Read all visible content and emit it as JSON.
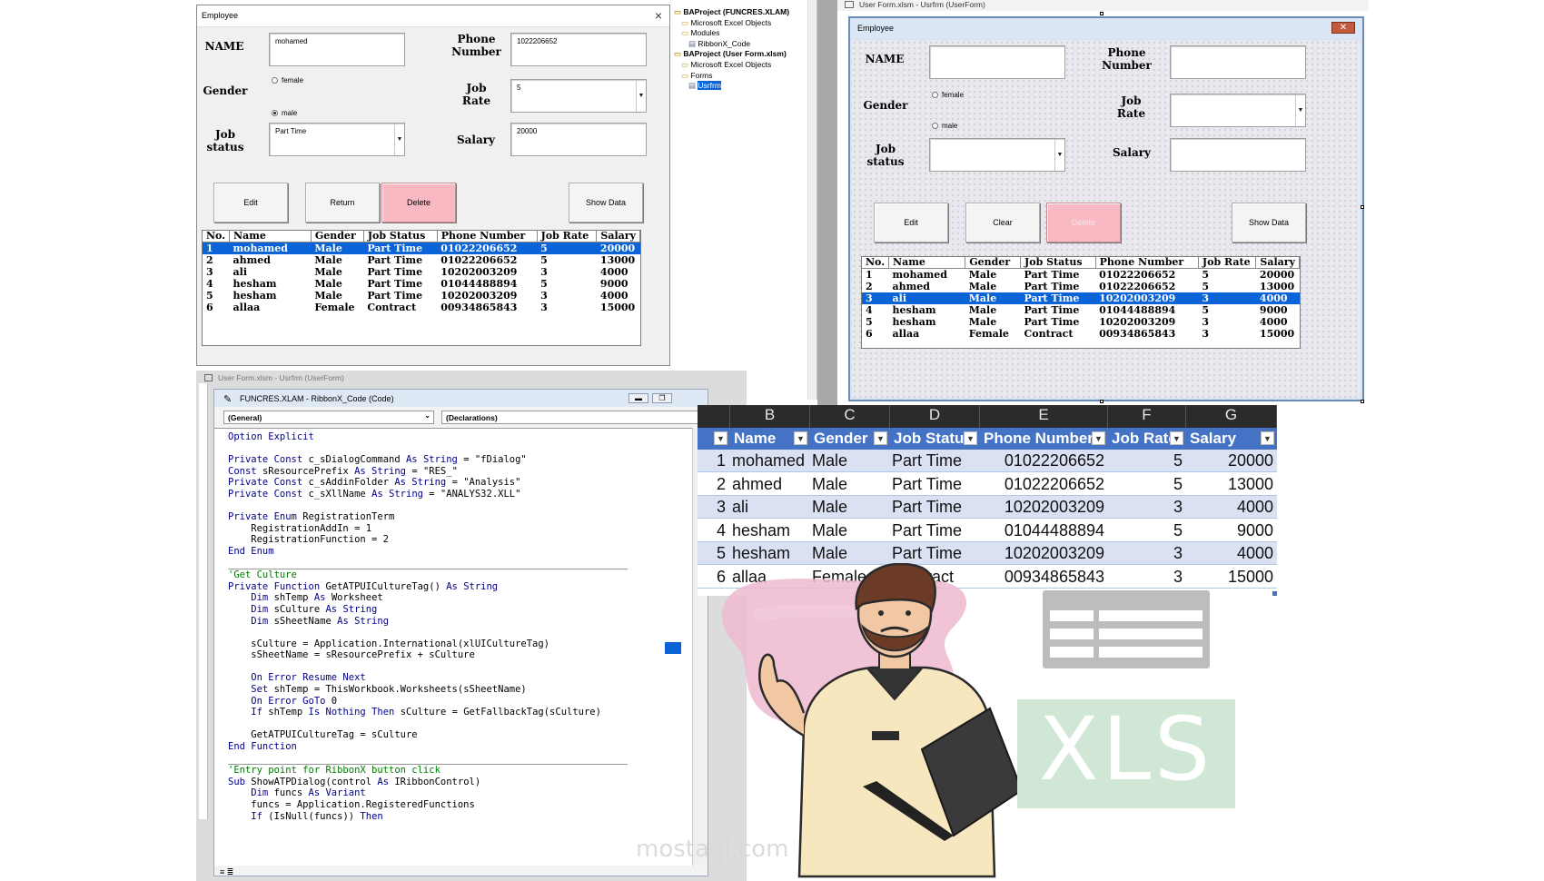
{
  "form1": {
    "title": "Employee",
    "labels": {
      "name": "NAME",
      "phone": "Phone Number",
      "gender": "Gender",
      "job_rate": "Job Rate",
      "job_status": "Job status",
      "salary": "Salary"
    },
    "values": {
      "name": "mohamed",
      "phone": "1022206652",
      "job_rate": "5",
      "job_status": "Part Time",
      "salary": "20000"
    },
    "radios": {
      "female": "female",
      "male": "male"
    },
    "buttons": {
      "edit": "Edit",
      "return": "Return",
      "delete": "Delete",
      "show": "Show Data"
    },
    "columns": [
      "No.",
      "Name",
      "Gender",
      "Job Status",
      "Phone Number",
      "Job Rate",
      "Salary"
    ],
    "selected_row": 0,
    "rows": [
      [
        "1",
        "mohamed",
        "Male",
        "Part Time",
        "01022206652",
        "5",
        "20000"
      ],
      [
        "2",
        "ahmed",
        "Male",
        "Part Time",
        "01022206652",
        "5",
        "13000"
      ],
      [
        "3",
        "ali",
        "Male",
        "Part Time",
        "10202003209",
        "3",
        "4000"
      ],
      [
        "4",
        "hesham",
        "Male",
        "Part Time",
        "01044488894",
        "5",
        "9000"
      ],
      [
        "5",
        "hesham",
        "Male",
        "Part Time",
        "10202003209",
        "3",
        "4000"
      ],
      [
        "6",
        "allaa",
        "Female",
        "Contract",
        "00934865843",
        "3",
        "15000"
      ]
    ]
  },
  "project_tree": [
    "BAProject (FUNCRES.XLAM)",
    "Microsoft Excel Objects",
    "Modules",
    "RibbonX_Code",
    "BAProject (User Form.xlsm)",
    "Microsoft Excel Objects",
    "Forms",
    "Usrfrm"
  ],
  "designer": {
    "window_title": "User Form.xlsm - Usrfrm (UserForm)",
    "form_title": "Employee",
    "labels": {
      "name": "NAME",
      "phone": "Phone Number",
      "gender": "Gender",
      "job_rate": "Job Rate",
      "job_status": "Job status",
      "salary": "Salary"
    },
    "radios": {
      "female": "female",
      "male": "male"
    },
    "buttons": {
      "edit": "Edit",
      "clear": "Clear",
      "delete": "Delete",
      "show": "Show Data"
    },
    "columns": [
      "No.",
      "Name",
      "Gender",
      "Job Status",
      "Phone Number",
      "Job Rate",
      "Salary"
    ],
    "selected_row": 2,
    "rows": [
      [
        "1",
        "mohamed",
        "Male",
        "Part Time",
        "01022206652",
        "5",
        "20000"
      ],
      [
        "2",
        "ahmed",
        "Male",
        "Part Time",
        "01022206652",
        "5",
        "13000"
      ],
      [
        "3",
        "ali",
        "Male",
        "Part Time",
        "10202003209",
        "3",
        "4000"
      ],
      [
        "4",
        "hesham",
        "Male",
        "Part Time",
        "01044488894",
        "5",
        "9000"
      ],
      [
        "5",
        "hesham",
        "Male",
        "Part Time",
        "10202003209",
        "3",
        "4000"
      ],
      [
        "6",
        "allaa",
        "Female",
        "Contract",
        "00934865843",
        "3",
        "15000"
      ]
    ]
  },
  "code_window": {
    "back_title": "User Form.xlsm - Usrfrm (UserForm)",
    "title": "FUNCRES.XLAM - RibbonX_Code (Code)",
    "object_dropdown": "(General)",
    "proc_dropdown": "(Declarations)",
    "lines": [
      [
        [
          "k",
          "Option Explicit"
        ]
      ],
      [],
      [
        [
          "k",
          "Private Const "
        ],
        [
          "t",
          "c_sDialogCommand "
        ],
        [
          "k",
          "As String"
        ],
        [
          "t",
          " = \"fDialog\""
        ]
      ],
      [
        [
          "k",
          "Const "
        ],
        [
          "t",
          "sResourcePrefix "
        ],
        [
          "k",
          "As String"
        ],
        [
          "t",
          " = \"RES_\""
        ]
      ],
      [
        [
          "k",
          "Private Const "
        ],
        [
          "t",
          "c_sAddinFolder "
        ],
        [
          "k",
          "As String"
        ],
        [
          "t",
          " = \"Analysis\""
        ]
      ],
      [
        [
          "k",
          "Private Const "
        ],
        [
          "t",
          "c_sXllName "
        ],
        [
          "k",
          "As String"
        ],
        [
          "t",
          " = \"ANALYS32.XLL\""
        ]
      ],
      [],
      [
        [
          "k",
          "Private Enum "
        ],
        [
          "t",
          "RegistrationTerm"
        ]
      ],
      [
        [
          "t",
          "    RegistrationAddIn = 1"
        ]
      ],
      [
        [
          "t",
          "    RegistrationFunction = 2"
        ]
      ],
      [
        [
          "k",
          "End Enum"
        ]
      ],
      [
        [
          "sep",
          ""
        ]
      ],
      [
        [
          "c",
          "'Get Culture"
        ]
      ],
      [
        [
          "k",
          "Private Function "
        ],
        [
          "t",
          "GetATPUICultureTag() "
        ],
        [
          "k",
          "As String"
        ]
      ],
      [
        [
          "k",
          "    Dim "
        ],
        [
          "t",
          "shTemp "
        ],
        [
          "k",
          "As "
        ],
        [
          "t",
          "Worksheet"
        ]
      ],
      [
        [
          "k",
          "    Dim "
        ],
        [
          "t",
          "sCulture "
        ],
        [
          "k",
          "As String"
        ]
      ],
      [
        [
          "k",
          "    Dim "
        ],
        [
          "t",
          "sSheetName "
        ],
        [
          "k",
          "As String"
        ]
      ],
      [],
      [
        [
          "t",
          "    sCulture = Application.International(xlUICultureTag)"
        ]
      ],
      [
        [
          "t",
          "    sSheetName = sResourcePrefix + sCulture"
        ]
      ],
      [],
      [
        [
          "k",
          "    On Error Resume Next"
        ]
      ],
      [
        [
          "k",
          "    Set "
        ],
        [
          "t",
          "shTemp = ThisWorkbook.Worksheets(sSheetName)"
        ]
      ],
      [
        [
          "k",
          "    On Error GoTo "
        ],
        [
          "t",
          "0"
        ]
      ],
      [
        [
          "k",
          "    If "
        ],
        [
          "t",
          "shTemp "
        ],
        [
          "k",
          "Is Nothing Then "
        ],
        [
          "t",
          "sCulture = GetFallbackTag(sCulture)"
        ]
      ],
      [],
      [
        [
          "t",
          "    GetATPUICultureTag = sCulture"
        ]
      ],
      [
        [
          "k",
          "End Function"
        ]
      ],
      [
        [
          "sep",
          ""
        ]
      ],
      [
        [
          "c",
          "'Entry point for RibbonX button click"
        ]
      ],
      [
        [
          "k",
          "Sub "
        ],
        [
          "t",
          "ShowATPDialog(control "
        ],
        [
          "k",
          "As "
        ],
        [
          "t",
          "IRibbonControl)"
        ]
      ],
      [
        [
          "k",
          "    Dim "
        ],
        [
          "t",
          "funcs "
        ],
        [
          "k",
          "As Variant"
        ]
      ],
      [
        [
          "t",
          "    funcs = Application.RegisteredFunctions"
        ]
      ],
      [
        [
          "k",
          "    If "
        ],
        [
          "t",
          "(IsNull(funcs)) "
        ],
        [
          "k",
          "Then"
        ]
      ]
    ]
  },
  "sheet": {
    "col_letters": [
      "B",
      "C",
      "D",
      "E",
      "F",
      "G"
    ],
    "headers": [
      "Name",
      "Gender",
      "Job Status",
      "Phone Number",
      "Job Rate",
      "Salary"
    ],
    "rows": [
      [
        "1",
        "mohamed",
        "Male",
        "Part Time",
        "01022206652",
        "5",
        "20000"
      ],
      [
        "2",
        "ahmed",
        "Male",
        "Part Time",
        "01022206652",
        "5",
        "13000"
      ],
      [
        "3",
        "ali",
        "Male",
        "Part Time",
        "10202003209",
        "3",
        "4000"
      ],
      [
        "4",
        "hesham",
        "Male",
        "Part Time",
        "01044488894",
        "5",
        "9000"
      ],
      [
        "5",
        "hesham",
        "Male",
        "Part Time",
        "10202003209",
        "3",
        "4000"
      ],
      [
        "6",
        "allaa",
        "Female",
        "Contract",
        "00934865843",
        "3",
        "15000"
      ]
    ]
  },
  "decor": {
    "xls_text": "XLS",
    "watermark": "mostaql.com",
    "colors": {
      "excel_green": "#21a366",
      "header_blue": "#4472c4",
      "selection_blue": "#0a64d8",
      "delete_pink": "#f8b9c3"
    }
  }
}
